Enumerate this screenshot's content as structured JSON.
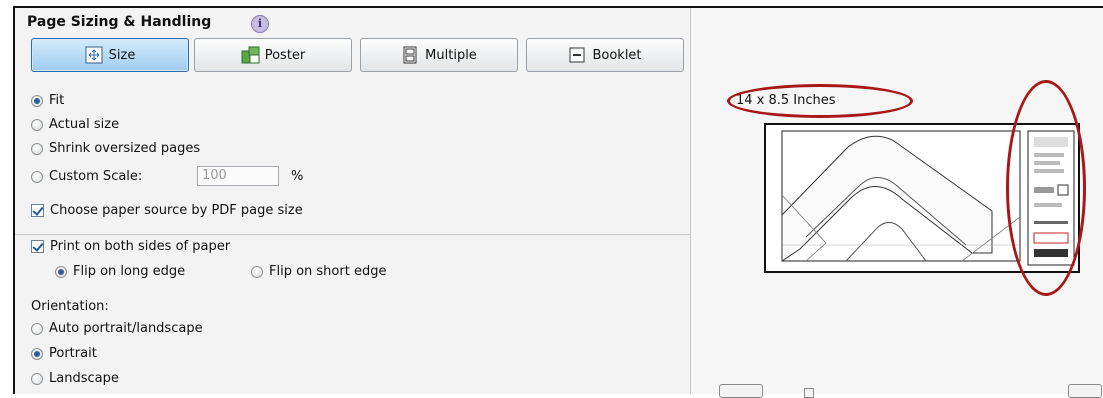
{
  "section": {
    "title": "Page Sizing & Handling",
    "info_icon": "info-icon"
  },
  "buttons": [
    {
      "label": "Size",
      "icon": "size-icon",
      "active": true
    },
    {
      "label": "Poster",
      "icon": "poster-icon",
      "active": false
    },
    {
      "label": "Multiple",
      "icon": "multiple-icon",
      "active": false
    },
    {
      "label": "Booklet",
      "icon": "booklet-icon",
      "active": false
    }
  ],
  "sizing_options": [
    {
      "label": "Fit",
      "selected": true
    },
    {
      "label": "Actual size",
      "selected": false
    },
    {
      "label": "Shrink oversized pages",
      "selected": false
    },
    {
      "label": "Custom Scale:",
      "selected": false
    }
  ],
  "custom_scale": {
    "value": "100",
    "unit": "%"
  },
  "paper_source": {
    "label": "Choose paper source by PDF page size",
    "checked": true
  },
  "duplex": {
    "label": "Print on both sides of paper",
    "checked": true,
    "options": [
      {
        "label": "Flip on long edge",
        "selected": true
      },
      {
        "label": "Flip on short edge",
        "selected": false
      }
    ]
  },
  "orientation": {
    "title": "Orientation:",
    "options": [
      {
        "label": "Auto portrait/landscape",
        "selected": false
      },
      {
        "label": "Portrait",
        "selected": true
      },
      {
        "label": "Landscape",
        "selected": false
      }
    ]
  },
  "preview": {
    "size_label": "14 x 8.5 Inches"
  },
  "colors": {
    "accent": "#2f6eae",
    "annotation": "#a81818",
    "panel": "#f3f3f3"
  }
}
